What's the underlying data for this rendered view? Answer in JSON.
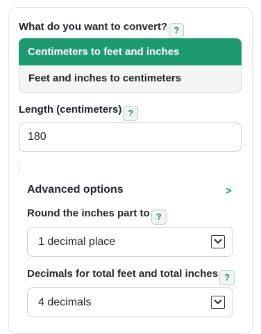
{
  "converter": {
    "mode_question": "What do you want to convert?",
    "help_symbol": "?",
    "modes": [
      {
        "label": "Centimeters to feet and inches",
        "active": true
      },
      {
        "label": "Feet and inches to centimeters",
        "active": false
      }
    ],
    "length_label": "Length (centimeters)",
    "length_value": "180"
  },
  "advanced": {
    "title": "Advanced options",
    "toggle_glyph": ">",
    "round_label": "Round the inches part to",
    "round_value": "1 decimal place",
    "decimals_label": "Decimals for total feet and total inches",
    "decimals_value": "4 decimals"
  },
  "colors": {
    "accent": "#1e9a73",
    "inactive_bg": "#f3f6f5"
  }
}
